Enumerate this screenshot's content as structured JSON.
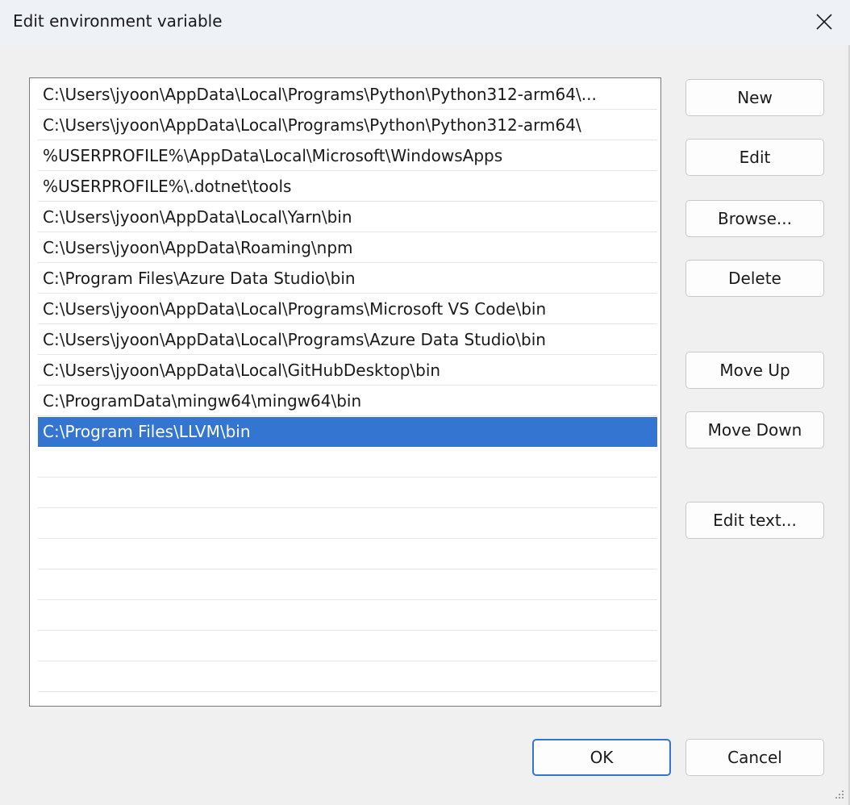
{
  "window": {
    "title": "Edit environment variable",
    "close_icon": "close-icon"
  },
  "list": {
    "items": [
      "C:\\Users\\jyoon\\AppData\\Local\\Programs\\Python\\Python312-arm64\\...",
      "C:\\Users\\jyoon\\AppData\\Local\\Programs\\Python\\Python312-arm64\\",
      "%USERPROFILE%\\AppData\\Local\\Microsoft\\WindowsApps",
      "%USERPROFILE%\\.dotnet\\tools",
      "C:\\Users\\jyoon\\AppData\\Local\\Yarn\\bin",
      "C:\\Users\\jyoon\\AppData\\Roaming\\npm",
      "C:\\Program Files\\Azure Data Studio\\bin",
      "C:\\Users\\jyoon\\AppData\\Local\\Programs\\Microsoft VS Code\\bin",
      "C:\\Users\\jyoon\\AppData\\Local\\Programs\\Azure Data Studio\\bin",
      "C:\\Users\\jyoon\\AppData\\Local\\GitHubDesktop\\bin",
      "C:\\ProgramData\\mingw64\\mingw64\\bin",
      "C:\\Program Files\\LLVM\\bin"
    ],
    "selected_index": 11,
    "empty_rows": 9
  },
  "buttons": {
    "new": "New",
    "edit": "Edit",
    "browse": "Browse...",
    "delete": "Delete",
    "move_up": "Move Up",
    "move_down": "Move Down",
    "edit_text": "Edit text...",
    "ok": "OK",
    "cancel": "Cancel"
  },
  "colors": {
    "selection": "#3375d0",
    "dialog_bg": "#f0f0f0",
    "titlebar_bg": "#eef2f6"
  }
}
